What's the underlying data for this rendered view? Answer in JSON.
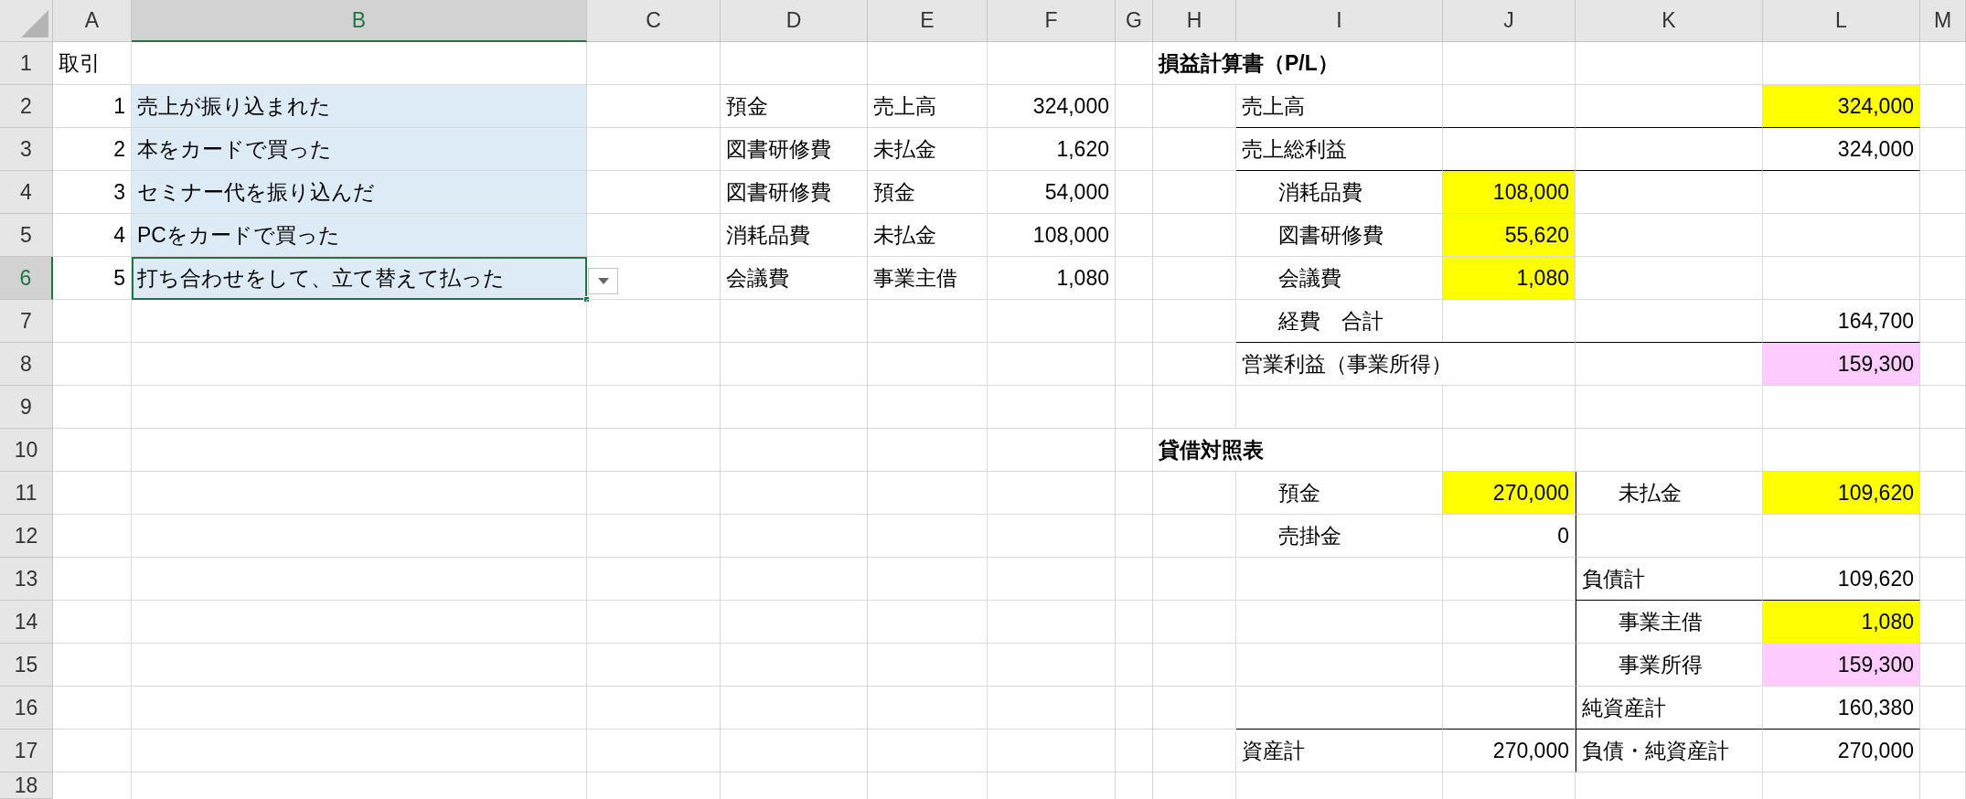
{
  "columns": [
    {
      "label": "A",
      "selected": false
    },
    {
      "label": "B",
      "selected": true
    },
    {
      "label": "C",
      "selected": false
    },
    {
      "label": "D",
      "selected": false
    },
    {
      "label": "E",
      "selected": false
    },
    {
      "label": "F",
      "selected": false
    },
    {
      "label": "G",
      "selected": false
    },
    {
      "label": "H",
      "selected": false
    },
    {
      "label": "I",
      "selected": false
    },
    {
      "label": "J",
      "selected": false
    },
    {
      "label": "K",
      "selected": false
    },
    {
      "label": "L",
      "selected": false
    },
    {
      "label": "M",
      "selected": false
    }
  ],
  "rows": [
    {
      "label": "1",
      "selected": false,
      "cells": [
        {
          "kind": "text",
          "text": "取引"
        },
        {},
        {},
        {},
        {},
        {},
        {},
        {
          "kind": "heading",
          "text": "損益計算書（P/L）"
        },
        {},
        {},
        {},
        {},
        {}
      ]
    },
    {
      "label": "2",
      "selected": false,
      "cells": [
        {
          "kind": "number",
          "text": "1"
        },
        {
          "kind": "text",
          "text": "売上が振り込まれた",
          "color": "#ddebf7"
        },
        {},
        {
          "kind": "text",
          "text": "預金"
        },
        {
          "kind": "text",
          "text": "売上高"
        },
        {
          "kind": "number",
          "text": "324,000"
        },
        {},
        {},
        {
          "kind": "text",
          "text": "売上高"
        },
        {},
        {},
        {
          "kind": "number",
          "text": "324,000",
          "color": "#ffff00"
        },
        {}
      ]
    },
    {
      "label": "3",
      "selected": false,
      "cells": [
        {
          "kind": "number",
          "text": "2"
        },
        {
          "kind": "text",
          "text": "本をカードで買った",
          "color": "#ddebf7"
        },
        {},
        {
          "kind": "text",
          "text": "図書研修費"
        },
        {
          "kind": "text",
          "text": "未払金"
        },
        {
          "kind": "number",
          "text": "1,620"
        },
        {},
        {},
        {
          "kind": "text",
          "text": "売上総利益",
          "border_top": true
        },
        {
          "border_top": true
        },
        {
          "border_top": true
        },
        {
          "kind": "number",
          "text": "324,000",
          "border_top": true
        },
        {}
      ]
    },
    {
      "label": "4",
      "selected": false,
      "cells": [
        {
          "kind": "number",
          "text": "3"
        },
        {
          "kind": "text",
          "text": "セミナー代を振り込んだ",
          "color": "#ddebf7"
        },
        {},
        {
          "kind": "text",
          "text": "図書研修費"
        },
        {
          "kind": "text",
          "text": "預金"
        },
        {
          "kind": "number",
          "text": "54,000"
        },
        {},
        {},
        {
          "kind": "indented",
          "text": "消耗品費",
          "border_top": true
        },
        {
          "kind": "number",
          "text": "108,000",
          "color": "#ffff00",
          "border_top": true
        },
        {
          "border_top": true
        },
        {
          "border_top": true
        },
        {}
      ]
    },
    {
      "label": "5",
      "selected": false,
      "cells": [
        {
          "kind": "number",
          "text": "4"
        },
        {
          "kind": "text",
          "text": "PCをカードで買った",
          "color": "#ddebf7"
        },
        {},
        {
          "kind": "text",
          "text": "消耗品費"
        },
        {
          "kind": "text",
          "text": "未払金"
        },
        {
          "kind": "number",
          "text": "108,000"
        },
        {},
        {},
        {
          "kind": "indented",
          "text": "図書研修費"
        },
        {
          "kind": "number",
          "text": "55,620",
          "color": "#ffff00"
        },
        {},
        {},
        {}
      ]
    },
    {
      "label": "6",
      "selected": true,
      "cells": [
        {
          "kind": "number",
          "text": "5"
        },
        {
          "kind": "text",
          "text": "打ち合わせをして、立て替えて払った",
          "color": "#ddebf7",
          "active": true
        },
        {},
        {
          "kind": "text",
          "text": "会議費"
        },
        {
          "kind": "text",
          "text": "事業主借"
        },
        {
          "kind": "number",
          "text": "1,080"
        },
        {},
        {},
        {
          "kind": "indented",
          "text": "会議費"
        },
        {
          "kind": "number",
          "text": "1,080",
          "color": "#ffff00"
        },
        {},
        {},
        {}
      ]
    },
    {
      "label": "7",
      "selected": false,
      "cells": [
        {},
        {},
        {},
        {},
        {},
        {},
        {},
        {},
        {
          "kind": "indented",
          "text": "経費　合計"
        },
        {},
        {},
        {
          "kind": "number",
          "text": "164,700"
        },
        {}
      ]
    },
    {
      "label": "8",
      "selected": false,
      "cells": [
        {},
        {},
        {},
        {},
        {},
        {},
        {},
        {},
        {
          "kind": "spill",
          "text": "営業利益（事業所得）",
          "border_top": true
        },
        {},
        {
          "border_top": true
        },
        {
          "kind": "number",
          "text": "159,300",
          "color": "#ffccff",
          "border_top": true
        },
        {}
      ]
    },
    {
      "label": "9",
      "selected": false
    },
    {
      "label": "10",
      "selected": false,
      "cells": [
        {},
        {},
        {},
        {},
        {},
        {},
        {},
        {
          "kind": "heading",
          "text": "貸借対照表"
        },
        {},
        {},
        {},
        {},
        {}
      ]
    },
    {
      "label": "11",
      "selected": false,
      "cells": [
        {},
        {},
        {},
        {},
        {},
        {},
        {},
        {},
        {
          "kind": "indented",
          "text": "預金"
        },
        {
          "kind": "number",
          "text": "270,000",
          "color": "#ffff00"
        },
        {
          "kind": "indented",
          "text": "未払金",
          "border_left": true
        },
        {
          "kind": "number",
          "text": "109,620",
          "color": "#ffff00"
        },
        {}
      ]
    },
    {
      "label": "12",
      "selected": false,
      "cells": [
        {},
        {},
        {},
        {},
        {},
        {},
        {},
        {},
        {
          "kind": "indented",
          "text": "売掛金"
        },
        {
          "kind": "number",
          "text": "0"
        },
        {
          "border_left": true
        },
        {},
        {}
      ]
    },
    {
      "label": "13",
      "selected": false,
      "cells": [
        {},
        {},
        {},
        {},
        {},
        {},
        {},
        {},
        {},
        {},
        {
          "kind": "text",
          "text": "負債計",
          "border_left": true
        },
        {
          "kind": "number",
          "text": "109,620"
        },
        {}
      ]
    },
    {
      "label": "14",
      "selected": false,
      "cells": [
        {},
        {},
        {},
        {},
        {},
        {},
        {},
        {},
        {},
        {},
        {
          "kind": "indented",
          "text": "事業主借",
          "border_top": true,
          "border_left": true
        },
        {
          "kind": "number",
          "text": "1,080",
          "color": "#ffff00",
          "border_top": true
        },
        {}
      ]
    },
    {
      "label": "15",
      "selected": false,
      "cells": [
        {},
        {},
        {},
        {},
        {},
        {},
        {},
        {},
        {},
        {},
        {
          "kind": "indented",
          "text": "事業所得",
          "border_left": true
        },
        {
          "kind": "number",
          "text": "159,300",
          "color": "#ffccff"
        },
        {}
      ]
    },
    {
      "label": "16",
      "selected": false,
      "cells": [
        {},
        {},
        {},
        {},
        {},
        {},
        {},
        {},
        {},
        {},
        {
          "kind": "text",
          "text": "純資産計",
          "border_left": true
        },
        {
          "kind": "number",
          "text": "160,380"
        },
        {}
      ]
    },
    {
      "label": "17",
      "selected": false,
      "cells": [
        {},
        {},
        {},
        {},
        {},
        {},
        {},
        {},
        {
          "kind": "text",
          "text": "資産計",
          "border_top": true
        },
        {
          "kind": "number",
          "text": "270,000",
          "border_top": true
        },
        {
          "kind": "text",
          "text": "負債・純資産計",
          "border_top": true,
          "border_left": true
        },
        {
          "kind": "number",
          "text": "270,000",
          "border_top": true
        },
        {}
      ]
    },
    {
      "label": "18",
      "selected": false
    }
  ]
}
